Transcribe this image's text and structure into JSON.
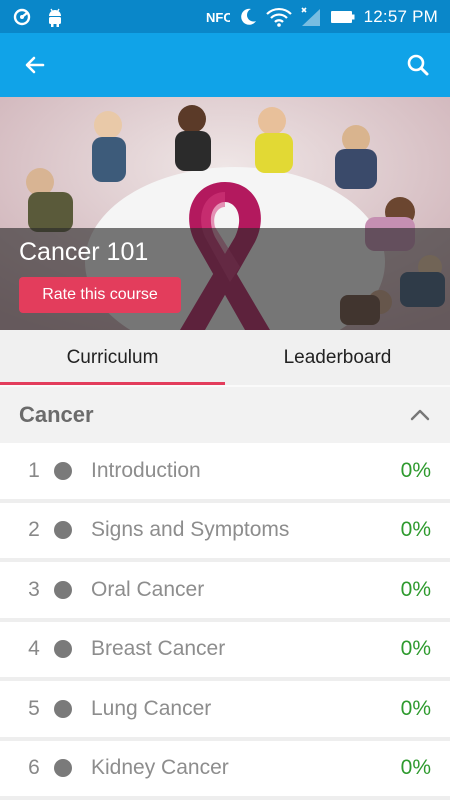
{
  "status_bar": {
    "time": "12:57 PM",
    "icons": [
      "sync-icon",
      "android-icon",
      "nfc-icon",
      "moon-icon",
      "wifi-icon",
      "signal-icon",
      "battery-icon"
    ],
    "nfc_label": "NFC"
  },
  "app_bar": {
    "back_icon": "arrow-back-icon",
    "search_icon": "search-icon",
    "color": "#10a3e8"
  },
  "course": {
    "title": "Cancer 101",
    "rate_label": "Rate this course",
    "accent": "#e33d5c"
  },
  "tabs": [
    {
      "label": "Curriculum",
      "active": true
    },
    {
      "label": "Leaderboard",
      "active": false
    }
  ],
  "section": {
    "title": "Cancer",
    "expanded": true
  },
  "lessons": [
    {
      "number": "1",
      "title": "Introduction",
      "progress": "0%"
    },
    {
      "number": "2",
      "title": "Signs and Symptoms",
      "progress": "0%"
    },
    {
      "number": "3",
      "title": "Oral Cancer",
      "progress": "0%"
    },
    {
      "number": "4",
      "title": "Breast Cancer",
      "progress": "0%"
    },
    {
      "number": "5",
      "title": "Lung Cancer",
      "progress": "0%"
    },
    {
      "number": "6",
      "title": "Kidney Cancer",
      "progress": "0%"
    }
  ]
}
